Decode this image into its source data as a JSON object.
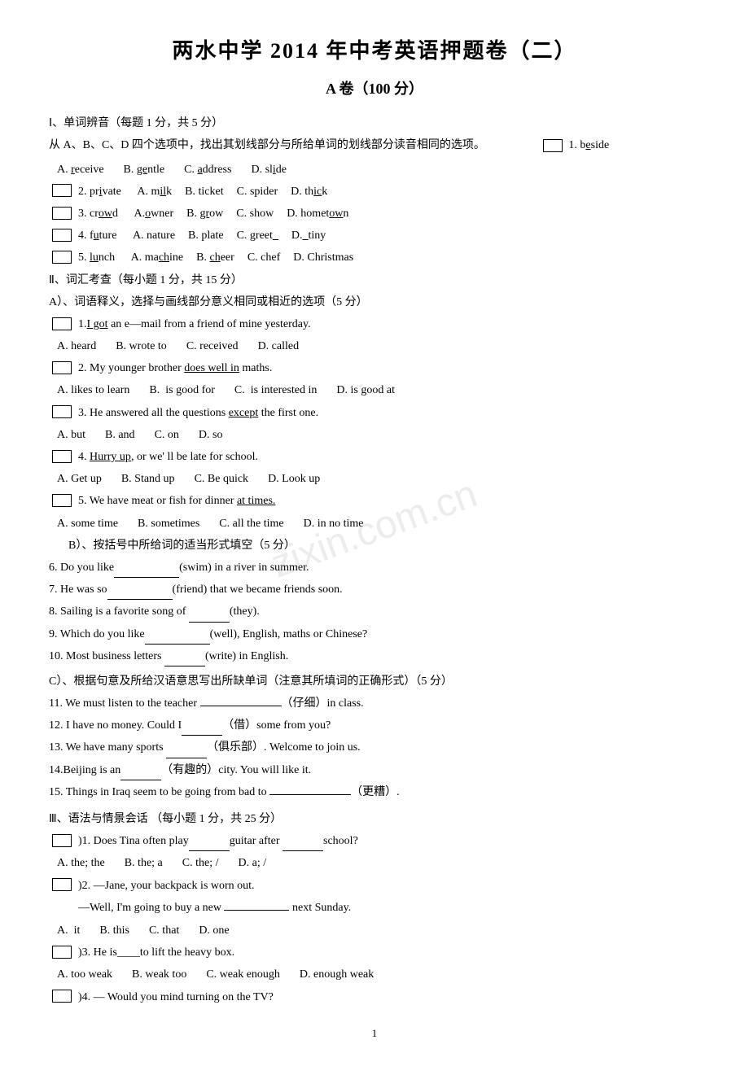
{
  "title": {
    "main": "两水中学 2014 年中考英语押题卷（二）",
    "sub": "A 卷（100 分）"
  },
  "section1": {
    "header": "Ⅰ、单词辨音（每题 1 分，共 5 分）",
    "desc": "从 A、B、C、D 四个选项中，找出其划线部分与所给单词的划线部分读音相同的选项。",
    "q1": {
      "bracket": "（  ）",
      "num": "1. b",
      "word_part": "e",
      "word_rest": "side",
      "options": [
        {
          "label": "A.",
          "word": "receive"
        },
        {
          "label": "B.",
          "word": "gentle",
          "underline": ""
        },
        {
          "label": "C.",
          "word": "address",
          "underline": ""
        },
        {
          "label": "D.",
          "word": "slide"
        }
      ]
    },
    "questions": [
      {
        "num": "（  ）2. private",
        "options": [
          {
            "label": "A.",
            "word": "milk",
            "underline": true
          },
          {
            "label": "B.",
            "word": "ticket"
          },
          {
            "label": "C.",
            "word": "spider"
          },
          {
            "label": "D.",
            "word": "thick",
            "underline": true
          }
        ]
      },
      {
        "num": "（  ）3. crowd",
        "options": [
          {
            "label": "A.",
            "word": "owner",
            "underline": true
          },
          {
            "label": "B.",
            "word": "grow",
            "underline": true
          },
          {
            "label": "C.",
            "word": "show"
          },
          {
            "label": "D.",
            "word": "hometown",
            "underline": true
          }
        ]
      },
      {
        "num": "（  ）4. future",
        "options": [
          {
            "label": "A.",
            "word": "nature"
          },
          {
            "label": "B.",
            "word": "plate"
          },
          {
            "label": "C.",
            "word": "greet",
            "underline": true
          },
          {
            "label": "D.",
            "word": "tiny",
            "underline": true
          }
        ]
      },
      {
        "num": "（  ）5. lunch",
        "options": [
          {
            "label": "A.",
            "word": "machine"
          },
          {
            "label": "B.",
            "word": "cheer",
            "underline": true
          },
          {
            "label": "C.",
            "word": "chef"
          },
          {
            "label": "D.",
            "word": "Christmas"
          }
        ]
      }
    ]
  },
  "section2": {
    "header": "Ⅱ、词汇考查（每小题 1 分，共 15 分）",
    "partA": {
      "title": "A）、词语释义，选择与画线部分意义相同或相近的选项（5 分）",
      "questions": [
        {
          "bracket": "（  ）",
          "text": "1.I got an e—mail from a friend of mine yesterday.",
          "underline": "I got",
          "options": [
            "A. heard",
            "B. wrote to",
            "C. received",
            "D. called"
          ]
        },
        {
          "bracket": "（  ）",
          "text": "2. My younger brother does well in maths.",
          "underline": "does well in",
          "options": [
            "A. likes to learn",
            "B.  is good for",
            "C.  is interested in",
            "D. is good at"
          ]
        },
        {
          "bracket": "（  ）",
          "text": "3. He answered all the questions except the first one.",
          "underline": "except",
          "options": [
            "A. but",
            "B. and",
            "C. on",
            "D. so"
          ]
        },
        {
          "bracket": "（  ）",
          "text": "4. Hurry up, or we'll be late for school.",
          "underline": "Hurry up",
          "options": [
            "A. Get up",
            "B. Stand up",
            "C. Be quick",
            "D. Look up"
          ]
        },
        {
          "bracket": "（  ）",
          "text": "5. We have meat or fish for dinner at times.",
          "underline": "at times",
          "options": [
            "A. some time",
            "B. sometimes",
            "C. all the time",
            "D. in no time"
          ]
        }
      ]
    },
    "partB": {
      "title": "B）、按括号中所给词的适当形式填空（5 分）",
      "questions": [
        "6. Do you like______________(swim) in a river in summer.",
        "7. He was so______________(friend) that we became friends soon.",
        "8. Sailing is a favorite song of ____________(they).",
        "9. Which do you like______________(well), English, maths or Chinese?",
        "10. Most business letters ____________(write) in English."
      ]
    },
    "partC": {
      "title": "C）、根据句意及所给汉语意思写出所缺单词（注意其所填词的正确形式）（5 分）",
      "questions": [
        "11. We must listen to the teacher                           (仔细) in class.",
        "12. I have no money. Could I_____(借) some from you?",
        "13. We have many sports _______ (俱乐部). Welcome to join us.",
        "14.Beijing is an_____(有趣的) city. You will like it.",
        "15. Things in Iraq seem to be going from bad to                          (更糟)."
      ]
    }
  },
  "section3": {
    "header": "Ⅲ、语法与情景会话  （每小题 1 分，共 25 分）",
    "questions": [
      {
        "bracket": "（  ）",
        "num": "1.",
        "text": "Does Tina often play_________guitar after ________school?",
        "options": [
          "A. the; the",
          "B. the; a",
          "C. the; /",
          "D. a; /"
        ]
      },
      {
        "bracket": "（  ）",
        "num": "2.",
        "text": "—Jane, your backpack is worn out.",
        "text2": "—Well, I'm going to buy a new            next Sunday.",
        "options": [
          "A. it",
          "B. this",
          "C. that",
          "D. one"
        ]
      },
      {
        "bracket": "（  ）",
        "num": "3.",
        "text": "He is____to lift the heavy box.",
        "options": [
          "A. too weak",
          "B. weak too",
          "C. weak enough",
          "D. enough weak"
        ]
      },
      {
        "bracket": "（  ）",
        "num": "4.",
        "text": "— Would you mind turning on the TV?"
      }
    ]
  },
  "watermark": "zixin.com.cn",
  "page_number": "1"
}
